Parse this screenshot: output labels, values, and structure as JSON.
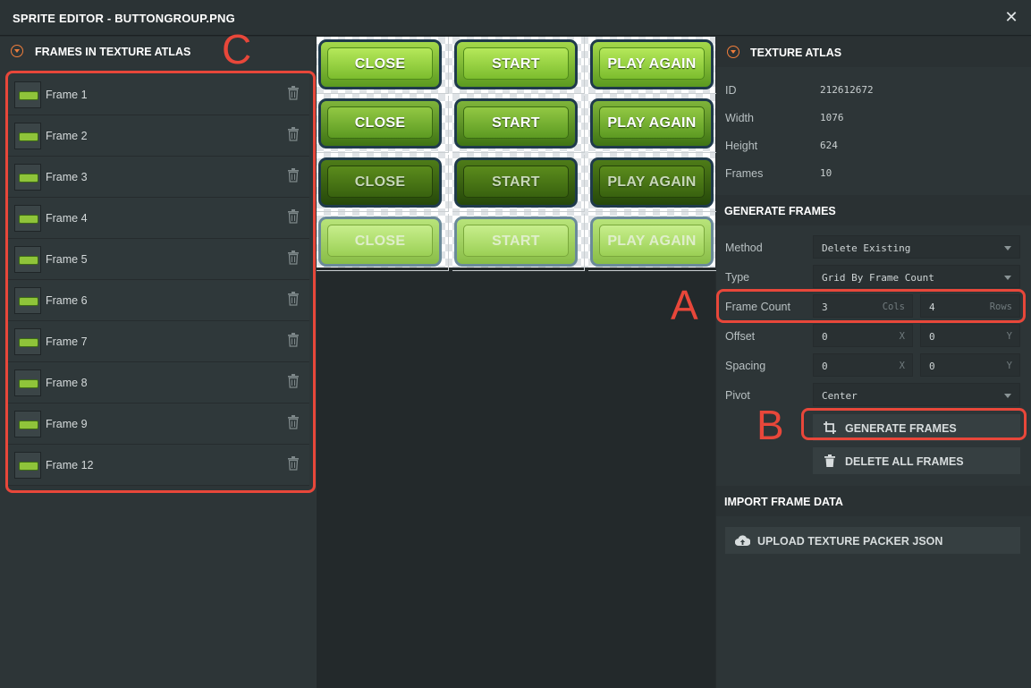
{
  "window": {
    "title": "SPRITE EDITOR - BUTTONGROUP.PNG"
  },
  "left_panel": {
    "header": "FRAMES IN TEXTURE ATLAS",
    "frames": [
      "Frame 1",
      "Frame 2",
      "Frame 3",
      "Frame 4",
      "Frame 5",
      "Frame 6",
      "Frame 7",
      "Frame 8",
      "Frame 9",
      "Frame 12"
    ]
  },
  "atlas": {
    "rows": [
      [
        "CLOSE",
        "START",
        "PLAY AGAIN"
      ],
      [
        "CLOSE",
        "START",
        "PLAY AGAIN"
      ],
      [
        "CLOSE",
        "START",
        "PLAY AGAIN"
      ],
      [
        "CLOSE",
        "START",
        "PLAY AGAIN"
      ]
    ]
  },
  "texture_atlas": {
    "header": "TEXTURE ATLAS",
    "id_label": "ID",
    "id_value": "212612672",
    "width_label": "Width",
    "width_value": "1076",
    "height_label": "Height",
    "height_value": "624",
    "frames_label": "Frames",
    "frames_value": "10"
  },
  "generate_frames": {
    "header": "GENERATE FRAMES",
    "method_label": "Method",
    "method_value": "Delete Existing",
    "type_label": "Type",
    "type_value": "Grid By Frame Count",
    "frame_count_label": "Frame Count",
    "cols_value": "3",
    "cols_suffix": "Cols",
    "rows_value": "4",
    "rows_suffix": "Rows",
    "offset_label": "Offset",
    "offset_x": "0",
    "offset_y": "0",
    "spacing_label": "Spacing",
    "spacing_x": "0",
    "spacing_y": "0",
    "x_suffix": "X",
    "y_suffix": "Y",
    "pivot_label": "Pivot",
    "pivot_value": "Center",
    "generate_button": "GENERATE FRAMES",
    "delete_button": "DELETE ALL FRAMES"
  },
  "import": {
    "header": "IMPORT FRAME DATA",
    "upload_button": "UPLOAD TEXTURE PACKER JSON"
  },
  "annotations": {
    "a": "A",
    "b": "B",
    "c": "C"
  },
  "colors": {
    "accent": "#f07e3c",
    "annotation": "#e8473a",
    "panel": "#2d3537"
  }
}
